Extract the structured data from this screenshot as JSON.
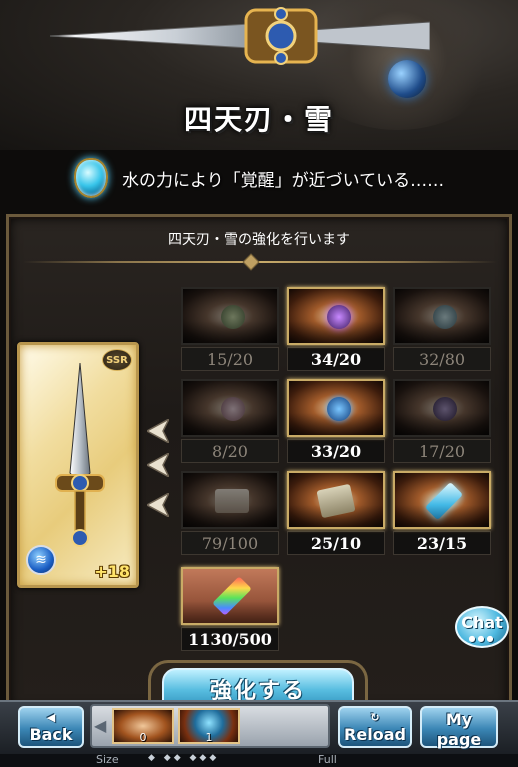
{
  "item": {
    "name": "四天刃・雪",
    "hint": "水の力により「覚醒」が近づいている……",
    "rarity": "SSR",
    "plus": "+18"
  },
  "panel": {
    "heading": "四天刃・雪の強化を行います"
  },
  "materials": [
    {
      "count": "15/20",
      "state": "inactive",
      "icon": "green-orb-icon"
    },
    {
      "count": "34/20",
      "state": "active",
      "icon": "dark-sphere-icon"
    },
    {
      "count": "32/80",
      "state": "inactive",
      "icon": "blue-flame-icon"
    },
    {
      "count": "8/20",
      "state": "inactive",
      "icon": "pink-flower-icon"
    },
    {
      "count": "33/20",
      "state": "active",
      "icon": "blue-planet-icon"
    },
    {
      "count": "17/20",
      "state": "inactive",
      "icon": "purple-orb-icon"
    },
    {
      "count": "79/100",
      "state": "inactive",
      "icon": "scroll-icon"
    },
    {
      "count": "25/10",
      "state": "active",
      "icon": "tablet-icon"
    },
    {
      "count": "23/15",
      "state": "active",
      "icon": "ice-crystal-icon"
    }
  ],
  "special_material": {
    "count": "1130/500",
    "icon": "rainbow-prism-icon"
  },
  "buttons": {
    "chat": "Chat",
    "enhance": "強化する",
    "back_arrow": "◀",
    "back": "Back",
    "reload_symbol": "↻",
    "reload": "Reload",
    "mypage_top": "My",
    "mypage_bottom": "page"
  },
  "tray": {
    "arrow": "◀",
    "slot1_count": "0",
    "slot2_count": "1"
  },
  "footer": {
    "size_label": "Size",
    "dots": "◆ ◆◆ ◆◆◆",
    "full_label": "Full"
  },
  "colors": {
    "accent_gold": "#c9ab66",
    "water_blue": "#38c5ea",
    "nav_blue": "#3b86b5"
  }
}
